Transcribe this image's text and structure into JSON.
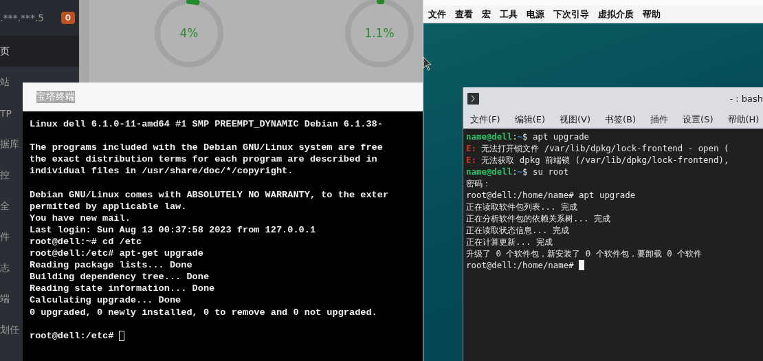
{
  "panel": {
    "sidebar": {
      "server": ".***.***.5",
      "badge": "0",
      "items": [
        {
          "label": "页",
          "selected": true
        },
        {
          "label": "站",
          "selected": false
        },
        {
          "label": "TP",
          "selected": false
        },
        {
          "label": "据库",
          "selected": false
        },
        {
          "label": "控",
          "selected": false
        },
        {
          "label": "全",
          "selected": false
        },
        {
          "label": "件",
          "selected": false
        },
        {
          "label": "志",
          "selected": false
        },
        {
          "label": "端",
          "selected": false
        },
        {
          "label": "划任",
          "selected": false
        }
      ]
    },
    "gauges": [
      {
        "value": "4%",
        "level": 0.04
      },
      {
        "value": "1.1%",
        "level": 0.011
      }
    ]
  },
  "web_terminal": {
    "title": "宝塔终端",
    "blocks": [
      [
        "Linux dell 6.1.0-11-amd64 #1 SMP PREEMPT_DYNAMIC Debian 6.1.38-"
      ],
      [
        "The programs included with the Debian GNU/Linux system are free",
        "the exact distribution terms for each program are described in",
        "individual files in /usr/share/doc/*/copyright."
      ],
      [
        "Debian GNU/Linux comes with ABSOLUTELY NO WARRANTY, to the exter",
        "permitted by applicable law.",
        "You have new mail.",
        "Last login: Sun Aug 13 00:37:58 2023 from 127.0.0.1",
        "root@dell:~# cd /etc",
        "root@dell:/etc# apt-get upgrade",
        "Reading package lists... Done",
        "Building dependency tree... Done",
        "Reading state information... Done",
        "Calculating upgrade... Done",
        "0 upgraded, 0 newly installed, 0 to remove and 0 not upgraded."
      ]
    ],
    "prompt": "root@dell:/etc#"
  },
  "vm": {
    "menu": [
      "文件",
      "查看",
      "宏",
      "工具",
      "电源",
      "下次引导",
      "虚拟介质",
      "帮助"
    ],
    "konsole": {
      "title": "- : bash",
      "menu": [
        "文件(F)",
        "编辑(E)",
        "视图(V)",
        "书签(B)",
        "插件",
        "设置(S)",
        "帮助(H)"
      ],
      "lines": [
        [
          {
            "kind": "user",
            "text": "name@dell"
          },
          {
            "kind": "text",
            "text": ":"
          },
          {
            "kind": "path",
            "text": "~"
          },
          {
            "kind": "text",
            "text": "$ apt upgrade"
          }
        ],
        [
          {
            "kind": "error",
            "text": "E:"
          },
          {
            "kind": "text",
            "text": " 无法打开锁文件 /var/lib/dpkg/lock-frontend - open ("
          }
        ],
        [
          {
            "kind": "error",
            "text": "E:"
          },
          {
            "kind": "text",
            "text": " 无法获取 dpkg 前端锁 (/var/lib/dpkg/lock-frontend),"
          }
        ],
        [
          {
            "kind": "user",
            "text": "name@dell"
          },
          {
            "kind": "text",
            "text": ":"
          },
          {
            "kind": "path",
            "text": "~"
          },
          {
            "kind": "text",
            "text": "$ su root"
          }
        ],
        [
          {
            "kind": "text",
            "text": "密码："
          }
        ],
        [
          {
            "kind": "text",
            "text": "root@dell:/home/name# apt upgrade"
          }
        ],
        [
          {
            "kind": "text",
            "text": "正在读取软件包列表... 完成"
          }
        ],
        [
          {
            "kind": "text",
            "text": "正在分析软件包的依赖关系树... 完成"
          }
        ],
        [
          {
            "kind": "text",
            "text": "正在读取状态信息... 完成"
          }
        ],
        [
          {
            "kind": "text",
            "text": "正在计算更新... 完成"
          }
        ],
        [
          {
            "kind": "text",
            "text": "升级了 0 个软件包，新安装了 0 个软件包，要卸载 0 个软件"
          }
        ]
      ],
      "prompt": "root@dell:/home/name#"
    }
  }
}
